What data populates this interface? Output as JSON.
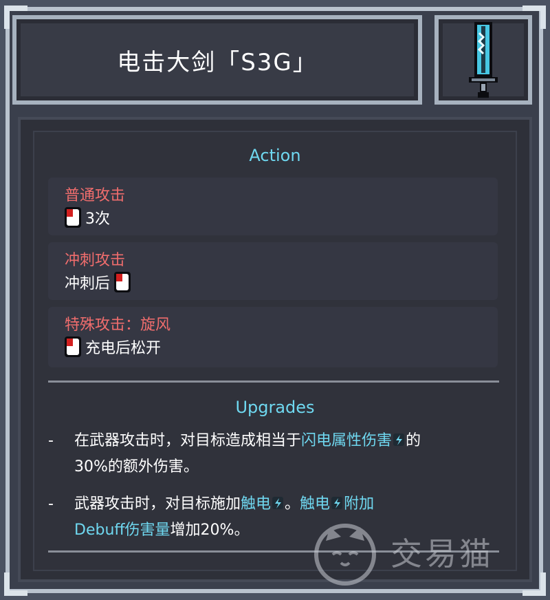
{
  "weapon": {
    "name": "电击大剑「S3G」",
    "icon": "electric-greatsword-icon"
  },
  "action": {
    "heading": "Action",
    "items": [
      {
        "title": "普通攻击",
        "pre": "",
        "post": "3次",
        "icon": "left-mouse-icon"
      },
      {
        "title": "冲刺攻击",
        "pre": "冲刺后",
        "post": "",
        "icon": "left-mouse-icon"
      },
      {
        "title": "特殊攻击：旋风",
        "pre": "",
        "post": "充电后松开",
        "icon": "left-mouse-icon"
      }
    ]
  },
  "upgrades": {
    "heading": "Upgrades",
    "items": [
      {
        "dash": "-",
        "line1_a": "在武器攻击时，对目标造成相当于",
        "line1_hl": "闪电属性伤害",
        "line1_b": "的",
        "line2": "30%的额外伤害。"
      },
      {
        "dash": "-",
        "line1_a": "武器攻击时，对目标施加",
        "line1_hl": "触电",
        "line1_b": "。",
        "line1_hl2": "触电",
        "line1_c": "附加",
        "line2_hl": "Debuff伤害量",
        "line2_b": "增加20%。"
      }
    ]
  },
  "watermark": {
    "text": "交易猫",
    "icon": "cat-logo-icon"
  },
  "colors": {
    "accent": "#6fd8f0",
    "title_red": "#f06d6d"
  }
}
